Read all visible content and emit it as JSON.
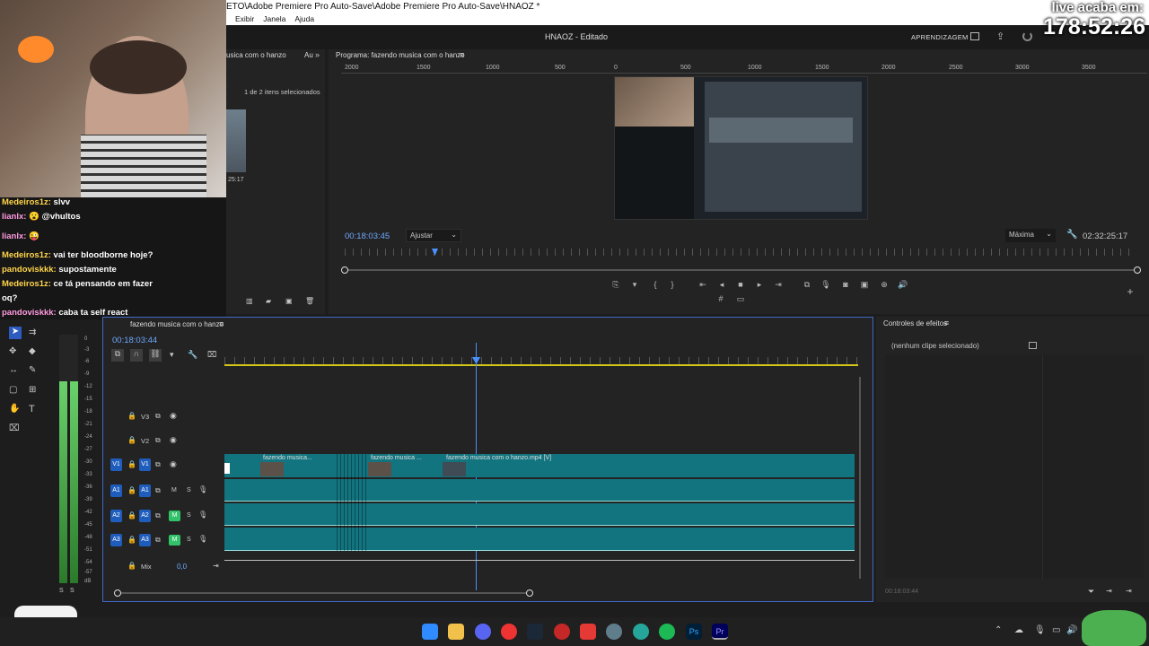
{
  "window": {
    "title": "ETO\\Adobe Premiere Pro Auto-Save\\Adobe Premiere Pro Auto-Save\\HNAOZ *",
    "menu": [
      "Exibir",
      "Janela",
      "Ajuda"
    ],
    "header_center": "HNAOZ - Editado",
    "learn_label": "APRENDIZAGEM"
  },
  "stream_overlay": {
    "timer_label": "live acaba em:",
    "timer_value": "178:52:26"
  },
  "chat": [
    {
      "user": "Medeiros1z:",
      "msg": "slvv"
    },
    {
      "user": "lianlx:",
      "msg": "@vhultos"
    },
    {
      "user": "lianlx:",
      "msg": ""
    },
    {
      "user": "Medeiros1z:",
      "msg": "vai ter bloodborne hoje?"
    },
    {
      "user": "pandoviskkk:",
      "msg": "supostamente"
    },
    {
      "user": "Medeiros1z:",
      "msg": "ce tá pensando em fazer"
    },
    {
      "user": "oq?",
      "msg": ""
    },
    {
      "user": "pandoviskkk:",
      "msg": "caba ta self react"
    }
  ],
  "project_panel": {
    "tab": "usica com o hanzo",
    "tab_short": "Au",
    "selection": "1 de 2 itens selecionados",
    "thumb_duration": "25:17"
  },
  "program_monitor": {
    "tab": "Programa: fazendo musica com o hanzo",
    "ruler_labels": [
      "2000",
      "1500",
      "1000",
      "500",
      "0",
      "500",
      "1000",
      "1500",
      "2000",
      "2500",
      "3000",
      "3500"
    ],
    "timecode": "00:18:03:45",
    "fit": "Ajustar",
    "quality": "Máxima",
    "duration": "02:32:25:17"
  },
  "timeline": {
    "tab": "fazendo musica com o hanzo",
    "timecode": "00:18:03:44",
    "tracks_video": [
      "V3",
      "V2",
      "V1"
    ],
    "tracks_audio": [
      "A1",
      "A2",
      "A3"
    ],
    "mix_label": "Mix",
    "mix_value": "0,0",
    "clips": [
      {
        "label": "fazendo musica..."
      },
      {
        "label": "fazendo musica ..."
      },
      {
        "label": "fazendo musica com o hanzo.mp4 [V]"
      }
    ],
    "track_mute": "M",
    "track_solo": "S"
  },
  "effects_panel": {
    "tab": "Controles de efeitos",
    "empty": "(nenhum clipe selecionado)",
    "footer_time": "00:18:03:44"
  },
  "audio_meter": {
    "scale": [
      "0",
      "-3",
      "-6",
      "-9",
      "-12",
      "-15",
      "-18",
      "-21",
      "-24",
      "-27",
      "-30",
      "-33",
      "-36",
      "-39",
      "-42",
      "-45",
      "-48",
      "-51",
      "-54",
      "-57",
      "dB"
    ],
    "footer": [
      "S",
      "S"
    ]
  },
  "colors": {
    "accent_blue": "#3f68c9",
    "clip_teal": "#12747f",
    "track_green": "#32c36a"
  }
}
